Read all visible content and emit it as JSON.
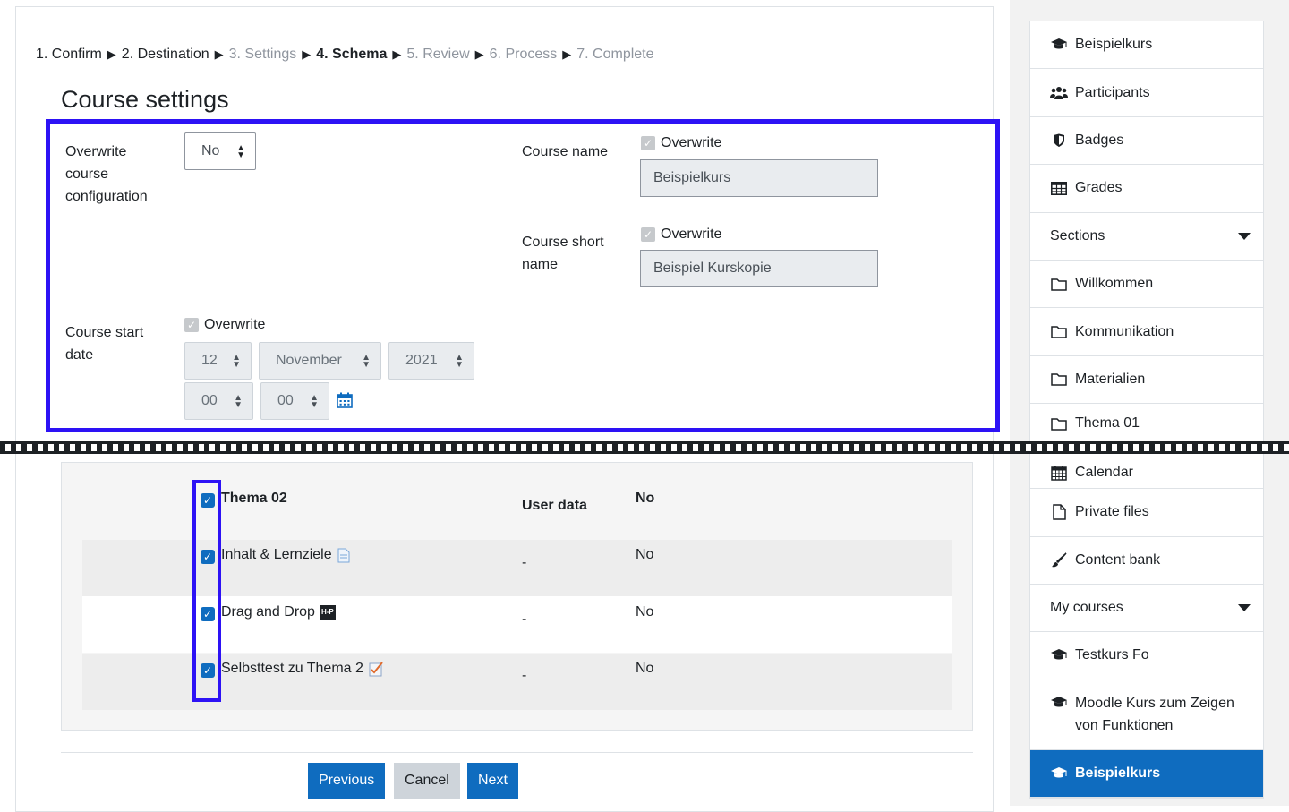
{
  "breadcrumb": {
    "step1": "1. Confirm",
    "step2": "2. Destination",
    "step3": "3. Settings",
    "step4": "4. Schema",
    "step5": "5. Review",
    "step6": "6. Process",
    "step7": "7. Complete",
    "separator": "▶"
  },
  "page_title": "Course settings",
  "settings": {
    "overwrite_config_label": "Overwrite course configuration",
    "overwrite_config_value": "No",
    "course_name_label": "Course name",
    "course_name_overwrite": "Overwrite",
    "course_name_value": "Beispielkurs",
    "short_name_label": "Course short name",
    "short_name_overwrite": "Overwrite",
    "short_name_value": "Beispiel Kurskopie",
    "start_date_label": "Course start date",
    "start_date_overwrite": "Overwrite",
    "day": "12",
    "month": "November",
    "year": "2021",
    "hour": "00",
    "minute": "00"
  },
  "schema": {
    "section_title": "Thema 02",
    "user_data_header": "User data",
    "section_no": "No",
    "rows": [
      {
        "label": "Inhalt & Lernziele",
        "user_data": "-",
        "value": "No",
        "icon": "page-icon"
      },
      {
        "label": "Drag and Drop",
        "user_data": "-",
        "value": "No",
        "icon": "h5p-icon",
        "badge": "H-P"
      },
      {
        "label": "Selbsttest zu Thema 2",
        "user_data": "-",
        "value": "No",
        "icon": "quiz-icon"
      }
    ]
  },
  "buttons": {
    "previous": "Previous",
    "cancel": "Cancel",
    "next": "Next"
  },
  "sidebar": {
    "items": [
      {
        "label": "Beispielkurs",
        "icon": "graduation-cap-icon"
      },
      {
        "label": "Participants",
        "icon": "users-icon"
      },
      {
        "label": "Badges",
        "icon": "shield-icon"
      },
      {
        "label": "Grades",
        "icon": "table-icon"
      },
      {
        "label": "Sections",
        "icon": "none"
      },
      {
        "label": "Willkommen",
        "icon": "folder-icon"
      },
      {
        "label": "Kommunikation",
        "icon": "folder-icon"
      },
      {
        "label": "Materialien",
        "icon": "folder-icon"
      },
      {
        "label": "Thema 01",
        "icon": "folder-icon"
      },
      {
        "label": "Calendar",
        "icon": "calendar-icon"
      },
      {
        "label": "Private files",
        "icon": "file-icon"
      },
      {
        "label": "Content bank",
        "icon": "brush-icon"
      },
      {
        "label": "My courses",
        "icon": "none"
      },
      {
        "label": "Testkurs Fo",
        "icon": "graduation-cap-icon"
      },
      {
        "label": "Moodle Kurs zum Zeigen von Funktionen",
        "icon": "graduation-cap-icon"
      },
      {
        "label": "Beispielkurs",
        "icon": "graduation-cap-icon"
      }
    ]
  },
  "colors": {
    "primary": "#0f6cbf",
    "highlight": "#2d12f5"
  }
}
